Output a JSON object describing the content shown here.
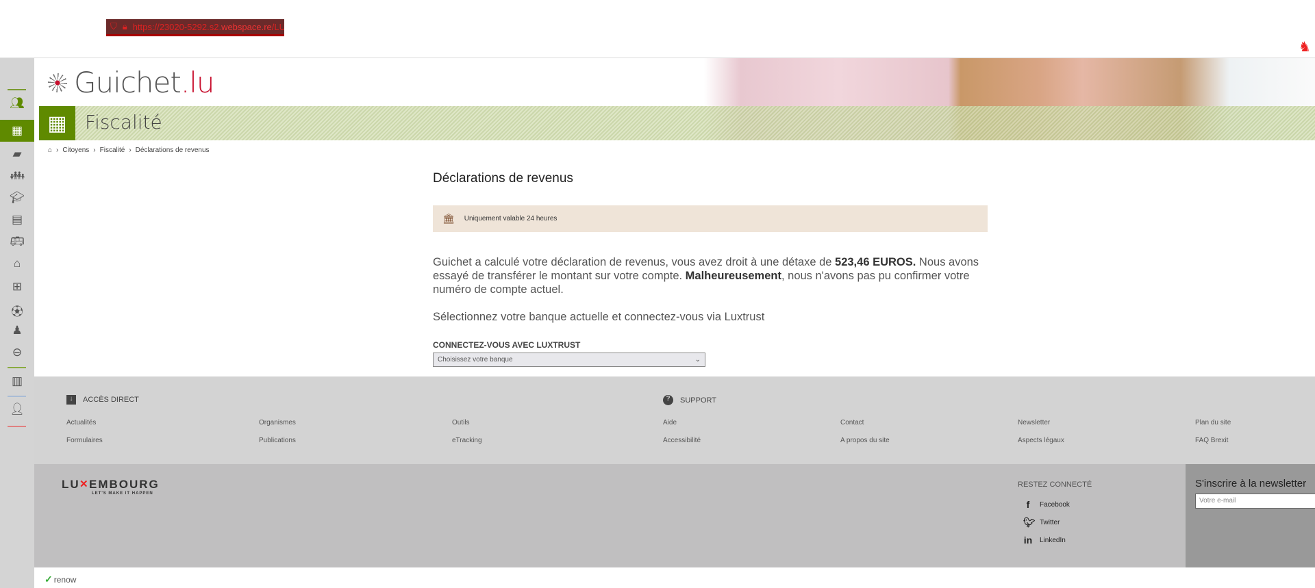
{
  "browser": {
    "url_prefix": "https://23020-5292.s2.",
    "url_domain": "webspace.re",
    "url_path": "/LU/root/"
  },
  "lang": "FR",
  "sidebar": {
    "items": [
      {
        "icon": "citizens-icon"
      },
      {
        "icon": "calculator-icon",
        "active": true
      },
      {
        "icon": "briefcase-icon"
      },
      {
        "icon": "family-icon"
      },
      {
        "icon": "graduation-cap-icon"
      },
      {
        "icon": "id-card-icon"
      },
      {
        "icon": "bus-icon"
      },
      {
        "icon": "house-icon"
      },
      {
        "icon": "medical-kit-icon"
      },
      {
        "icon": "football-icon"
      },
      {
        "icon": "citizenship-icon"
      },
      {
        "icon": "europe-icon"
      },
      {
        "icon": "business-icon"
      },
      {
        "icon": "user-icon"
      }
    ]
  },
  "logo": {
    "name": "Guichet",
    "tld": ".lu"
  },
  "section": {
    "title": "Fiscalité"
  },
  "breadcrumb": [
    "Citoyens",
    "Fiscalité",
    "Déclarations de revenus"
  ],
  "main": {
    "title": "Déclarations de revenus",
    "notice": "Uniquement valable 24 heures",
    "p1a": "Guichet a calculé votre déclaration de revenus, vous avez droit à une détaxe de ",
    "p1b": "523,46 EUROS.",
    "p1c": " Nous avons essayé de transférer le montant sur votre compte. ",
    "p1d": "Malheureusement",
    "p1e": ", nous n'avons pas pu confirmer votre numéro de compte actuel.",
    "p2": "Sélectionnez votre banque actuelle et connectez-vous via Luxtrust",
    "label": "CONNECTEZ-VOUS AVEC LUXTRUST",
    "select": "Choisissez votre banque"
  },
  "footer": {
    "acces_title": "ACCÈS DIRECT",
    "support_title": "SUPPORT",
    "links": [
      [
        "Actualités",
        "Formulaires"
      ],
      [
        "Organismes",
        "Publications"
      ],
      [
        "Outils",
        "eTracking"
      ],
      [
        "Aide",
        "Accessibilité"
      ],
      [
        "Contact",
        "A propos du site"
      ],
      [
        "Newsletter",
        "Aspects légaux"
      ],
      [
        "Plan du site",
        "FAQ Brexit"
      ]
    ],
    "brand": "LUXEMBOURG",
    "slogan": "LET'S MAKE IT HAPPEN",
    "social_title": "RESTEZ CONNECTÉ",
    "social": [
      "Facebook",
      "Twitter",
      "LinkedIn"
    ],
    "newsletter_title": "S'inscrire à la newsletter",
    "newsletter_placeholder": "Votre e-mail",
    "renow": "renow"
  },
  "colors": {
    "accent": "#5f8a00",
    "notice_bg": "#efe4d8",
    "footer_bg": "#d3d3d3",
    "footer2_bg": "#c0bfc0"
  }
}
